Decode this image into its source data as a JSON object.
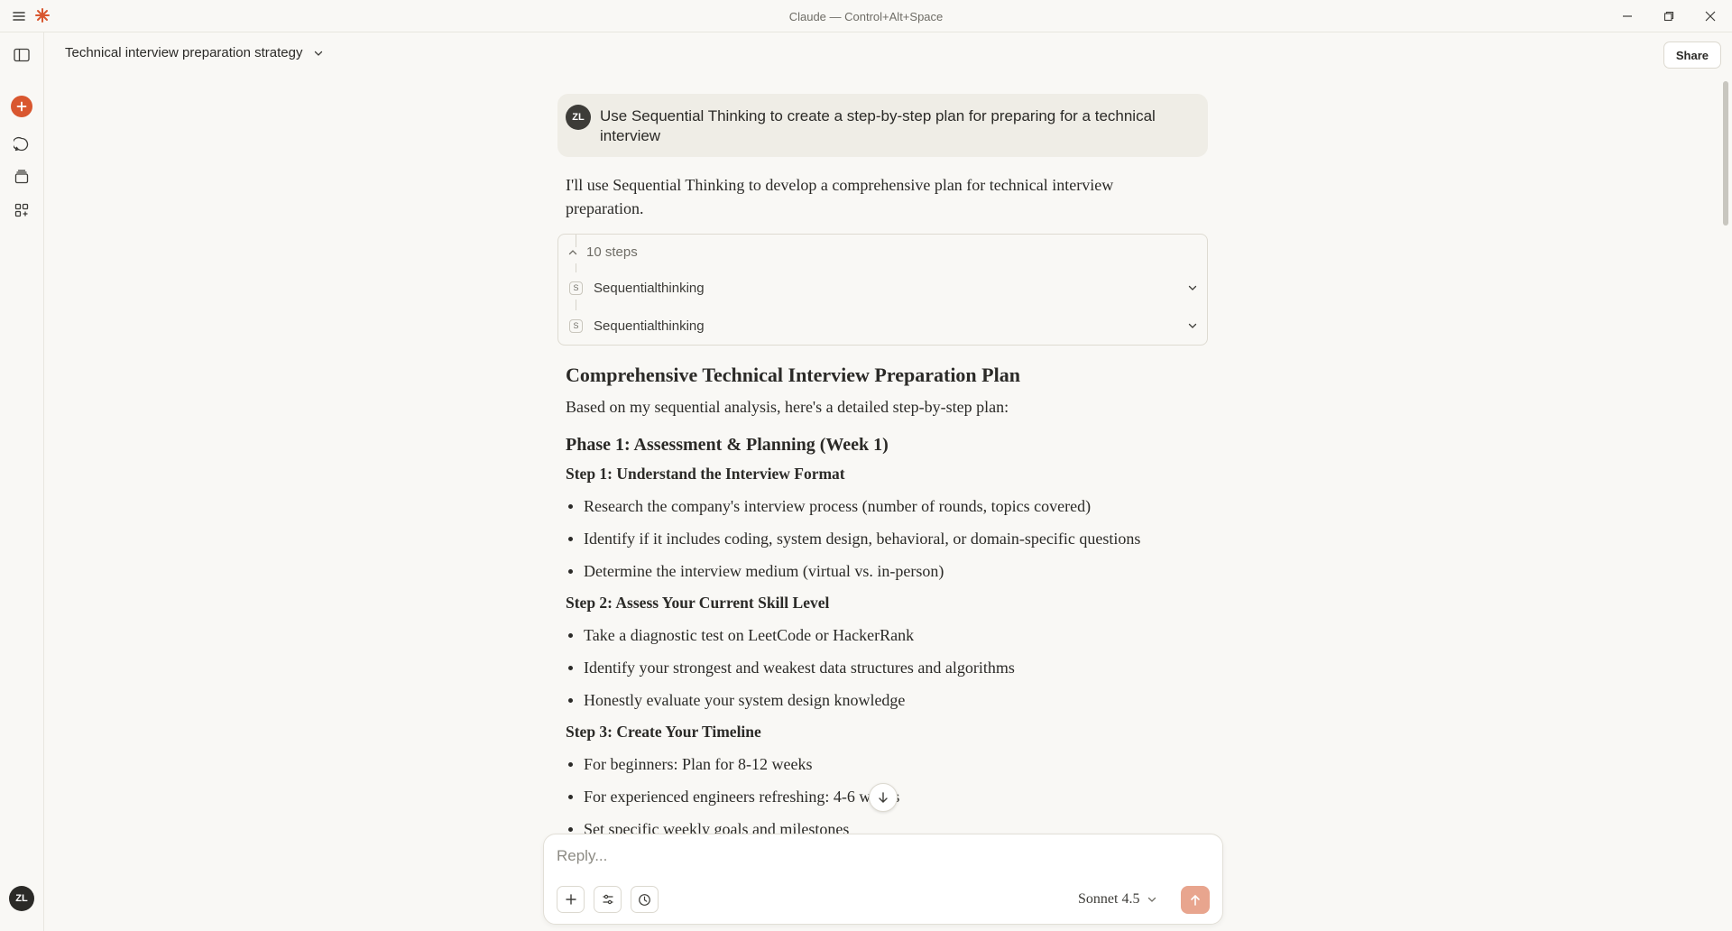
{
  "window": {
    "title": "Claude — Control+Alt+Space"
  },
  "header": {
    "conversation_title": "Technical interview preparation strategy",
    "share_label": "Share"
  },
  "sidebar": {
    "avatar_initials": "ZL"
  },
  "user_message": {
    "avatar_initials": "ZL",
    "text": "Use Sequential Thinking to create a step-by-step plan for preparing for a technical interview"
  },
  "assistant": {
    "intro": "I'll use Sequential Thinking to develop a comprehensive plan for technical interview preparation.",
    "steps": {
      "count_label": "10 steps",
      "items": [
        "Sequentialthinking",
        "Sequentialthinking"
      ],
      "badge": "S"
    },
    "heading": "Comprehensive Technical Interview Preparation Plan",
    "lead": "Based on my sequential analysis, here's a detailed step-by-step plan:",
    "phase1": "Phase 1: Assessment & Planning (Week 1)",
    "step1": {
      "title": "Step 1: Understand the Interview Format",
      "bullets": [
        "Research the company's interview process (number of rounds, topics covered)",
        "Identify if it includes coding, system design, behavioral, or domain-specific questions",
        "Determine the interview medium (virtual vs. in-person)"
      ]
    },
    "step2": {
      "title": "Step 2: Assess Your Current Skill Level",
      "bullets": [
        "Take a diagnostic test on LeetCode or HackerRank",
        "Identify your strongest and weakest data structures and algorithms",
        "Honestly evaluate your system design knowledge"
      ]
    },
    "step3": {
      "title": "Step 3: Create Your Timeline",
      "bullets": [
        "For beginners: Plan for 8-12 weeks",
        "For experienced engineers refreshing: 4-6 weeks",
        "Set specific weekly goals and milestones"
      ]
    }
  },
  "composer": {
    "placeholder": "Reply...",
    "model": "Sonnet 4.5"
  },
  "colors": {
    "accent": "#d9572f",
    "send": "#e8a58e",
    "background": "#f9f8f5"
  }
}
